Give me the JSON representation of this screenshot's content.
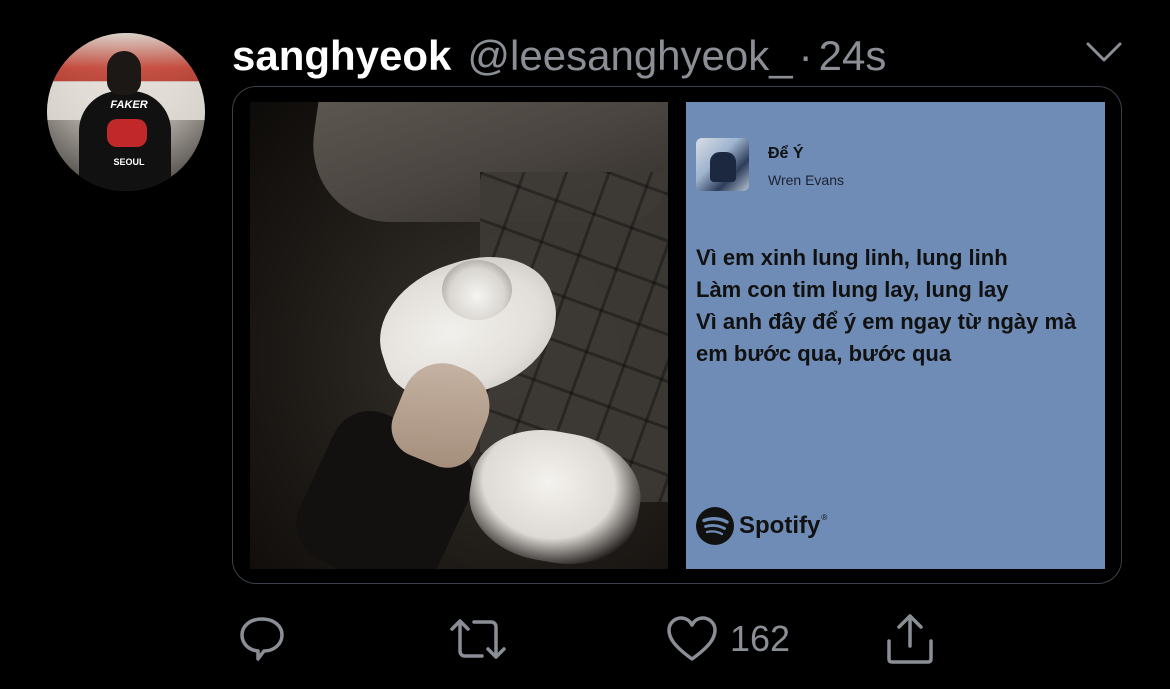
{
  "tweet": {
    "display_name": "sanghyeok",
    "handle": "@leesanghyeok_",
    "separator": "·",
    "time": "24s",
    "avatar": {
      "jacket_text": "FAKER",
      "jacket_subtext": "SEOUL"
    }
  },
  "share_card": {
    "song_title": "Để Ý",
    "artist": "Wren Evans",
    "lyrics": [
      "Vì em xinh lung linh, lung linh",
      "Làm con tim lung lay, lung lay",
      "Vì anh đây để ý em ngay từ ngày mà",
      "em bước qua, bước qua"
    ],
    "brand": "Spotify",
    "brand_mark": "®",
    "background_color": "#6e8cb6"
  },
  "actions": {
    "reply_icon": "reply-icon",
    "retweet_icon": "retweet-icon",
    "like_icon": "heart-icon",
    "like_count": "162",
    "share_icon": "share-icon"
  },
  "colors": {
    "background": "#000000",
    "secondary_text": "#8b8f95",
    "card_border": "#3b4148"
  }
}
